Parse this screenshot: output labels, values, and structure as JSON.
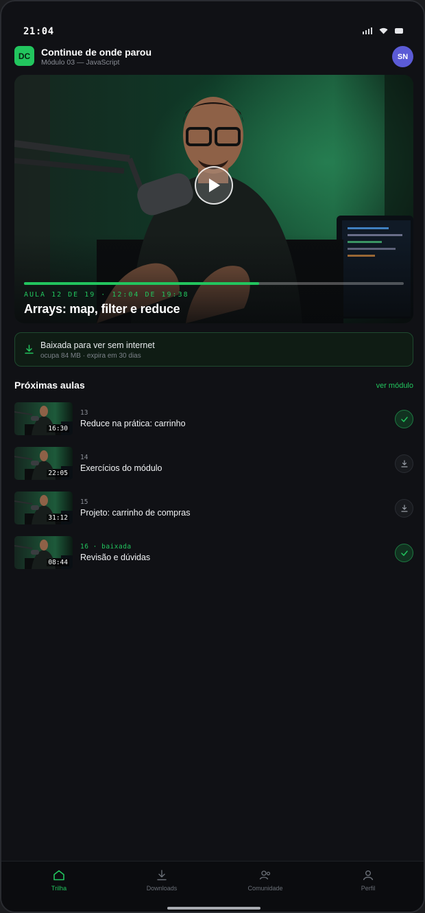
{
  "status_bar": {
    "time": "21:04"
  },
  "header": {
    "badge": "DC",
    "title": "Continue de onde parou",
    "subtitle": "Módulo 03 — JavaScript",
    "avatar": "SN"
  },
  "player": {
    "meta": "AULA 12 DE 19 · 12:04 DE 19:38",
    "title": "Arrays: map, filter e reduce",
    "progress": 0.62
  },
  "offline_banner": {
    "title": "Baixada para ver sem internet",
    "detail": "ocupa 84 MB · expira em 30 dias"
  },
  "section": {
    "title": "Próximas aulas",
    "link": "ver módulo"
  },
  "lessons": [
    {
      "num": "13",
      "title": "Reduce na prática: carrinho",
      "duration": "16:30",
      "state": "downloaded"
    },
    {
      "num": "14",
      "title": "Exercícios do módulo",
      "duration": "22:05",
      "state": "download"
    },
    {
      "num": "15",
      "title": "Projeto: carrinho de compras",
      "duration": "31:12",
      "state": "download"
    },
    {
      "num": "16 · baixada",
      "title": "Revisão e dúvidas",
      "duration": "08:44",
      "state": "downloaded"
    }
  ],
  "tabbar": {
    "items": [
      {
        "label": "Trilha",
        "icon": "home-icon",
        "active": true
      },
      {
        "label": "Downloads",
        "icon": "download-icon",
        "active": false
      },
      {
        "label": "Comunidade",
        "icon": "community-icon",
        "active": false
      },
      {
        "label": "Perfil",
        "icon": "profile-icon",
        "active": false
      }
    ]
  },
  "colors": {
    "accent": "#22c55e",
    "background": "#101115",
    "avatar": "#5b5bd6"
  }
}
